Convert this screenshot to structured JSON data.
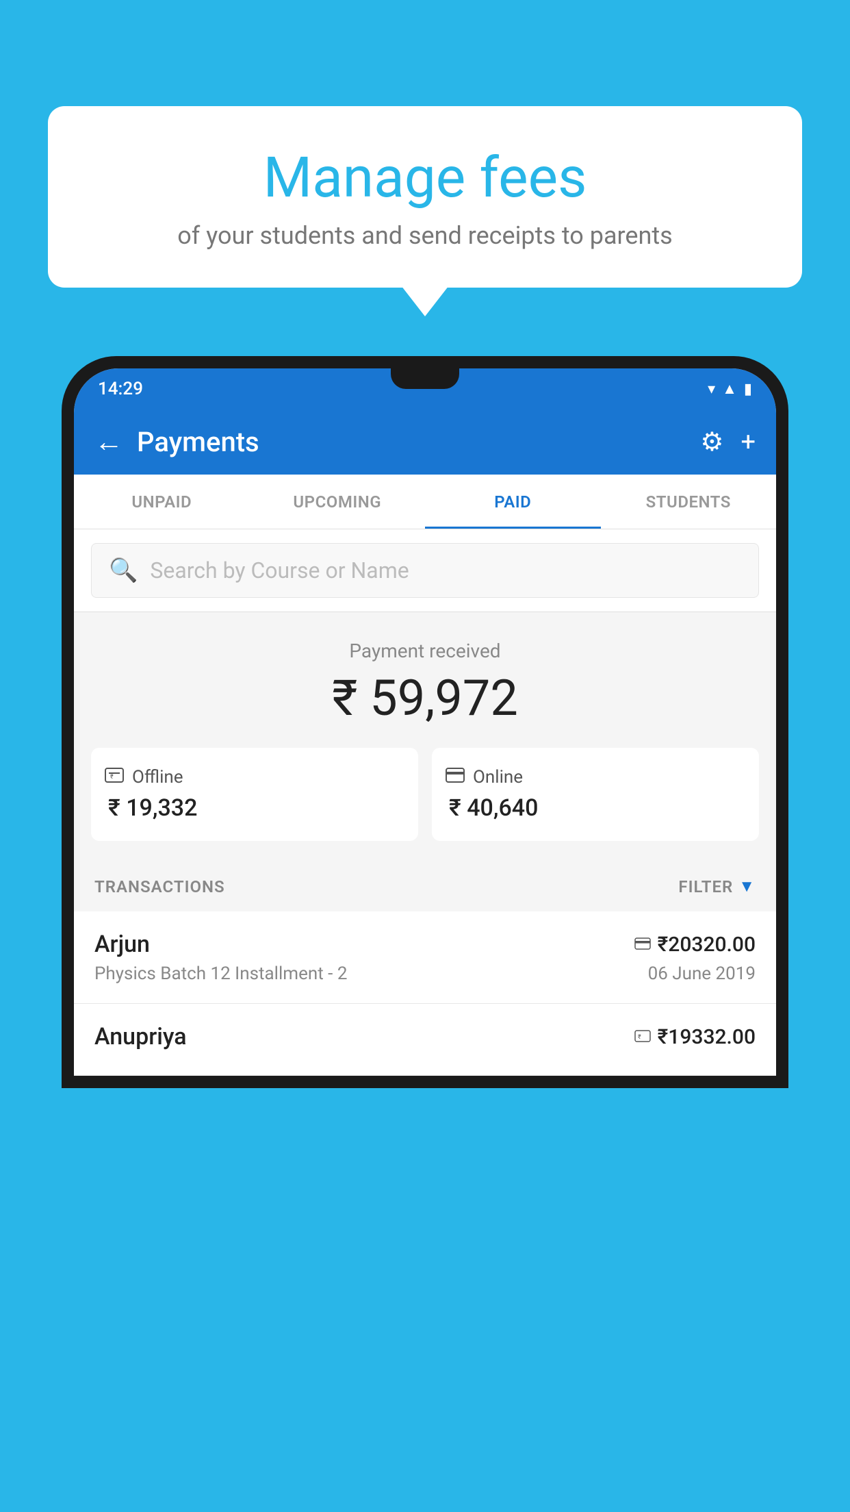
{
  "background_color": "#29B6E8",
  "bubble": {
    "title": "Manage fees",
    "subtitle": "of your students and send receipts to parents"
  },
  "phone": {
    "status_bar": {
      "time": "14:29",
      "icons": "▾◂▪"
    },
    "app_bar": {
      "title": "Payments",
      "back_label": "←",
      "settings_label": "⚙",
      "add_label": "+"
    },
    "tabs": [
      {
        "label": "UNPAID",
        "active": false
      },
      {
        "label": "UPCOMING",
        "active": false
      },
      {
        "label": "PAID",
        "active": true
      },
      {
        "label": "STUDENTS",
        "active": false
      }
    ],
    "search": {
      "placeholder": "Search by Course or Name"
    },
    "payment_summary": {
      "label": "Payment received",
      "amount": "₹ 59,972",
      "cards": [
        {
          "icon": "💳",
          "label": "Offline",
          "amount": "₹ 19,332"
        },
        {
          "icon": "💳",
          "label": "Online",
          "amount": "₹ 40,640"
        }
      ]
    },
    "transactions": {
      "section_label": "TRANSACTIONS",
      "filter_label": "FILTER",
      "items": [
        {
          "name": "Arjun",
          "course": "Physics Batch 12 Installment - 2",
          "amount": "₹20320.00",
          "date": "06 June 2019",
          "pay_type": "online"
        },
        {
          "name": "Anupriya",
          "course": "",
          "amount": "₹19332.00",
          "date": "",
          "pay_type": "offline"
        }
      ]
    }
  }
}
